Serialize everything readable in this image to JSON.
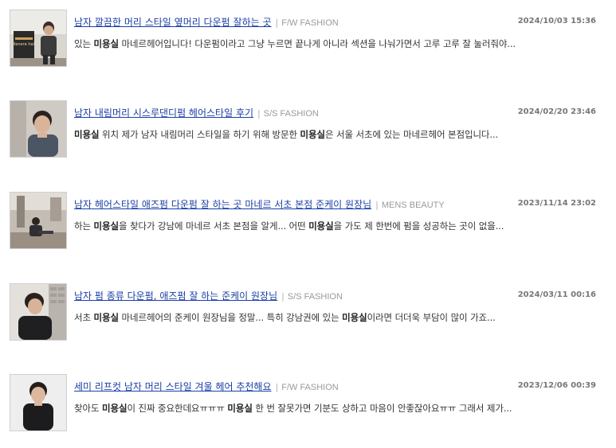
{
  "posts": [
    {
      "title": "남자 깔끔한 머리 스타일 옆머리 다운펌 잘하는 곳",
      "category": "F/W FASHION",
      "date": "2024/10/03 15:36",
      "snippet_before": "있는 ",
      "keyword": "미용실",
      "snippet_after": " 마네르헤어입니다! 다운펌이라고 그냥 누르면 끝나게 아니라 섹션을 나눠가면서 고루 고루 잘 눌러줘야...",
      "thumb_sign": "Manera hair"
    },
    {
      "title": "남자 내림머리 시스루댄디펌 헤어스타일 후기",
      "category": "S/S FASHION",
      "date": "2024/02/20 23:46",
      "snippet_before": "",
      "keyword": "미용실",
      "snippet_mid": " 위치 제가 남자 내림머리 스타일을 하기 위해 방문한 ",
      "keyword2": "미용실",
      "snippet_after": "은 서울 서초에 있는 마네르헤어 본점입니다..."
    },
    {
      "title": "남자 헤어스타일 애즈펌 다운펌 잘 하는 곳 마네르 서초 본점 준케이 원장님",
      "category": "MENS BEAUTY",
      "date": "2023/11/14 23:02",
      "snippet_before": "하는 ",
      "keyword": "미용실",
      "snippet_mid": "을 찾다가 강남에 마네르 서초 본점을 알게... 어떤 ",
      "keyword2": "미용실",
      "snippet_after": "을 가도 제 한번에 펌을 성공하는 곳이 없을..."
    },
    {
      "title": "남자 펌 종류 다운펌, 애즈펌 잘 하는 준케이 원장님",
      "category": "S/S FASHION",
      "date": "2024/03/11 00:16",
      "snippet_before": "서초 ",
      "keyword": "미용실",
      "snippet_mid": " 마네르헤어의 준케이 원장님을 정말... 특히 강남권에 있는 ",
      "keyword2": "미용실",
      "snippet_after": "이라면 더더욱 부담이 많이 가죠..."
    },
    {
      "title": "세미 리프컷 남자 머리 스타일 겨울 헤어 추천해요",
      "category": "F/W FASHION",
      "date": "2023/12/06 00:39",
      "snippet_before": "찾아도 ",
      "keyword": "미용실",
      "snippet_mid": "이 진짜 중요한데요ㅠㅠㅠ ",
      "keyword2": "미용실",
      "snippet_after": " 한 번 잘못가면 기분도 상하고 마음이 안좋잖아요ㅠㅠ 그래서 제가..."
    }
  ],
  "separator": "|"
}
